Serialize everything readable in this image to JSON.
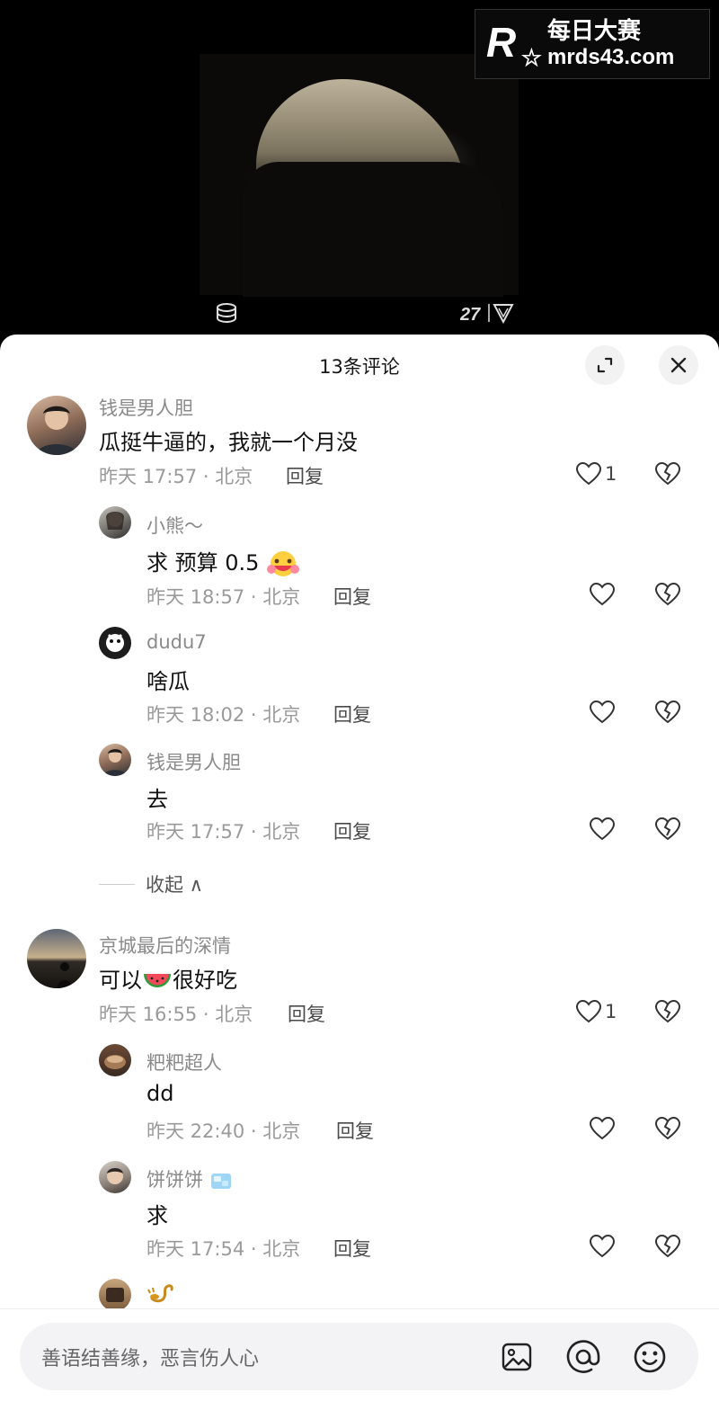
{
  "watermark": {
    "title": "每日大赛",
    "domain": "mrds43.com",
    "logo_letter": "R"
  },
  "sheet": {
    "title": "13条评论"
  },
  "comments": [
    {
      "user": "钱是男人胆",
      "text": "瓜挺牛逼的，我就一个月没",
      "time": "昨天 17:57 · 北京",
      "reply": "回复",
      "likes": "1",
      "replies": [
        {
          "user": "小熊～",
          "text": "求 预算 0.5",
          "time": "昨天 18:57 · 北京",
          "reply": "回复"
        },
        {
          "user": "dudu7",
          "text": "啥瓜",
          "time": "昨天 18:02 · 北京",
          "reply": "回复"
        },
        {
          "user": "钱是男人胆",
          "text": "去",
          "time": "昨天 17:57 · 北京",
          "reply": "回复"
        }
      ],
      "collapse": "收起 ∧"
    },
    {
      "user": "京城最后的深情",
      "text_a": "可以",
      "text_b": "很好吃",
      "time": "昨天 16:55 · 北京",
      "reply": "回复",
      "likes": "1",
      "replies": [
        {
          "user": "粑粑超人",
          "text": "dd",
          "time": "昨天 22:40 · 北京",
          "reply": "回复"
        },
        {
          "user": "饼饼饼",
          "text": "求",
          "time": "昨天 17:54 · 北京",
          "reply": "回复"
        }
      ]
    }
  ],
  "input": {
    "placeholder": "善语结善缘，恶言伤人心"
  },
  "icons": [
    "coin-stack-icon",
    "brand-badge-icon",
    "expand-icon",
    "close-icon",
    "heart-icon",
    "broken-heart-icon",
    "image-icon",
    "at-icon",
    "emoji-icon",
    "scorpion-icon",
    "watermelon-icon",
    "blush-emoji-icon",
    "ice-cube-icon"
  ]
}
